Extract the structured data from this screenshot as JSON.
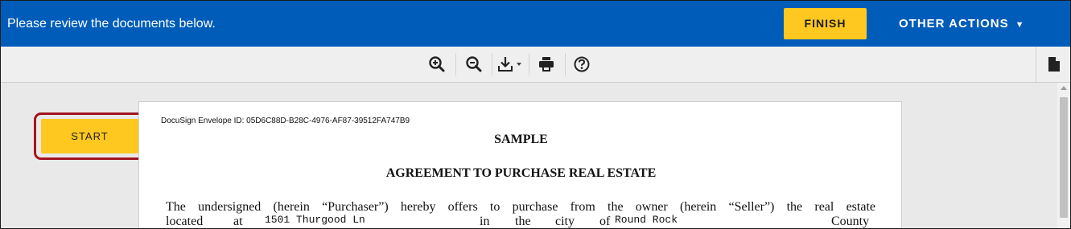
{
  "topbar": {
    "message": "Please review the documents below.",
    "finish_label": "FINISH",
    "other_actions_label": "OTHER ACTIONS",
    "other_actions_caret": "▼",
    "bg_color": "#005cb9",
    "accent_color": "#ffc820"
  },
  "toolbar": {
    "icons": [
      "zoom-in-icon",
      "zoom-out-icon",
      "download-icon",
      "print-icon",
      "help-icon",
      "document-icon"
    ]
  },
  "sidebar": {
    "start_label": "START",
    "highlight_color": "#a3151f"
  },
  "document": {
    "envelope_id": "DocuSign Envelope ID: 05D6C88D-B28C-4976-AF87-39512FA747B9",
    "heading": "SAMPLE",
    "title": "AGREEMENT TO PURCHASE REAL ESTATE",
    "paragraph_line1": "The undersigned (herein “Purchaser”) hereby offers to purchase from the owner (herein “Seller”) the real estate",
    "located_word": "located",
    "at_word": "at",
    "in_word": "in",
    "the_word": "the",
    "city_word": "city",
    "of_word": "of",
    "county_word": "County",
    "address_value": "1501 Thurgood Ln",
    "city_value": "Round Rock"
  }
}
